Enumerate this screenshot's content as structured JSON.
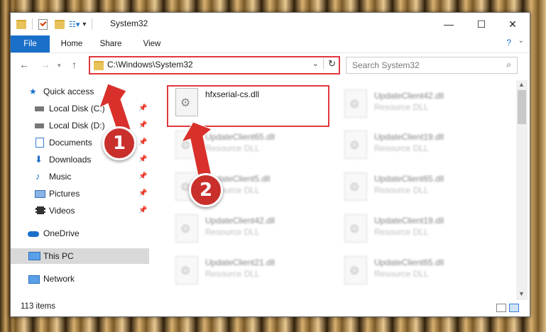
{
  "window": {
    "title": "System32",
    "controls": {
      "minimize": "—",
      "maximize": "☐",
      "close": "✕"
    }
  },
  "ribbon": {
    "tabs": [
      "File",
      "Home",
      "Share",
      "View"
    ]
  },
  "address": {
    "path": "C:\\Windows\\System32",
    "search_placeholder": "Search System32"
  },
  "sidebar": {
    "items": [
      {
        "label": "Quick access",
        "icon": "star-icon"
      },
      {
        "label": "Local Disk (C:)",
        "icon": "drive-icon",
        "pinned": true
      },
      {
        "label": "Local Disk (D:)",
        "icon": "drive-icon",
        "pinned": true
      },
      {
        "label": "Documents",
        "icon": "documents-icon",
        "pinned": true
      },
      {
        "label": "Downloads",
        "icon": "downloads-icon",
        "pinned": true
      },
      {
        "label": "Music",
        "icon": "music-icon",
        "pinned": true
      },
      {
        "label": "Pictures",
        "icon": "pictures-icon",
        "pinned": true
      },
      {
        "label": "Videos",
        "icon": "videos-icon",
        "pinned": true
      },
      {
        "label": "OneDrive",
        "icon": "cloud-icon"
      },
      {
        "label": "This PC",
        "icon": "computer-icon",
        "selected": true
      },
      {
        "label": "Network",
        "icon": "network-icon"
      }
    ]
  },
  "files": {
    "highlighted": {
      "name": "hfxserial-cs.dll",
      "type": ""
    },
    "column1": [
      {
        "name": "UpdateClient65.dll",
        "type": "Resource DLL"
      },
      {
        "name": "UpdateClient5.dll",
        "type": "Resource DLL"
      },
      {
        "name": "UpdateClient42.dll",
        "type": "Resource DLL"
      },
      {
        "name": "UpdateClient21.dll",
        "type": "Resource DLL"
      }
    ],
    "column2": [
      {
        "name": "UpdateClient42.dll",
        "type": "Resource DLL"
      },
      {
        "name": "UpdateClient19.dll",
        "type": "Resource DLL"
      },
      {
        "name": "UpdateClient65.dll",
        "type": "Resource DLL"
      },
      {
        "name": "UpdateClient19.dll",
        "type": "Resource DLL"
      },
      {
        "name": "UpdateClient65.dll",
        "type": "Resource DLL"
      }
    ]
  },
  "status": {
    "item_count": "113 items"
  },
  "annotations": {
    "step1": "1",
    "step2": "2",
    "color": "#e0383e"
  }
}
